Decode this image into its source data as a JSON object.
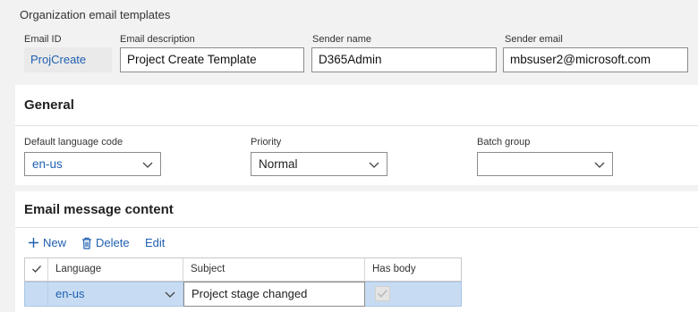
{
  "header": {
    "section_title": "Organization email templates",
    "email_id_label": "Email ID",
    "email_id_value": "ProjCreate",
    "email_description_label": "Email description",
    "email_description_value": "Project Create Template",
    "sender_name_label": "Sender name",
    "sender_name_value": "D365Admin",
    "sender_email_label": "Sender email",
    "sender_email_value": "mbsuser2@microsoft.com"
  },
  "general": {
    "title": "General",
    "default_language_label": "Default language code",
    "default_language_value": "en-us",
    "priority_label": "Priority",
    "priority_value": "Normal",
    "batch_group_label": "Batch group",
    "batch_group_value": ""
  },
  "content": {
    "title": "Email message content",
    "toolbar": {
      "new_label": "New",
      "delete_label": "Delete",
      "edit_label": "Edit"
    },
    "columns": {
      "language": "Language",
      "subject": "Subject",
      "has_body": "Has body"
    },
    "rows": [
      {
        "language": "en-us",
        "subject": "Project stage changed",
        "has_body": true
      }
    ]
  },
  "colors": {
    "accent": "#1f5fb0",
    "selected_row": "#c7dcf2"
  }
}
